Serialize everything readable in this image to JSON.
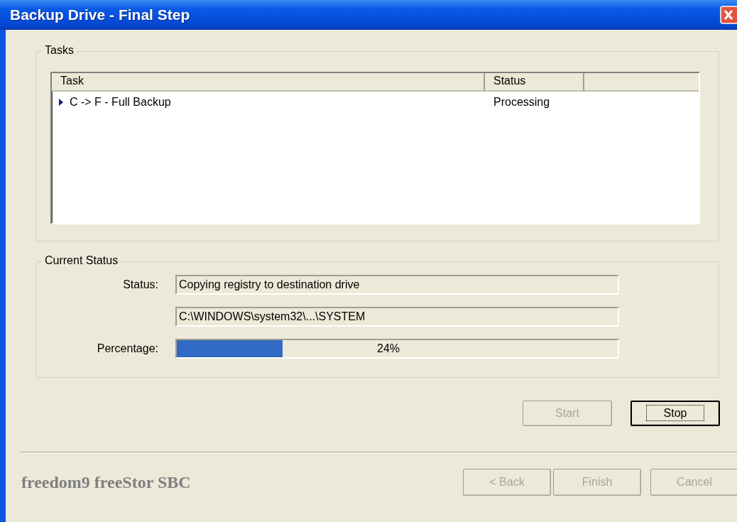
{
  "window": {
    "title": "Backup Drive - Final Step"
  },
  "tasks": {
    "label": "Tasks",
    "columns": [
      "Task",
      "Status"
    ],
    "rows": [
      {
        "task": "C -> F - Full Backup",
        "status": "Processing",
        "current": true
      }
    ]
  },
  "current_status": {
    "label": "Current Status",
    "status_label": "Status:",
    "status": "Copying registry to destination drive",
    "path": "C:\\WINDOWS\\system32\\...\\SYSTEM",
    "percentage_label": "Percentage:",
    "level": 0.24,
    "percentage": "24%"
  },
  "action_buttons": [
    {
      "label": "Start",
      "disabled": true,
      "focused": false
    },
    {
      "label": "Stop",
      "disabled": false,
      "focused": true
    }
  ],
  "footer": {
    "brand": "freedom9 freeStor SBC",
    "buttons": [
      {
        "label": "< Back",
        "disabled": true,
        "focused": false
      },
      {
        "label": "Finish",
        "disabled": true,
        "focused": false
      },
      {
        "label": "Cancel",
        "disabled": true,
        "focused": false
      }
    ]
  }
}
